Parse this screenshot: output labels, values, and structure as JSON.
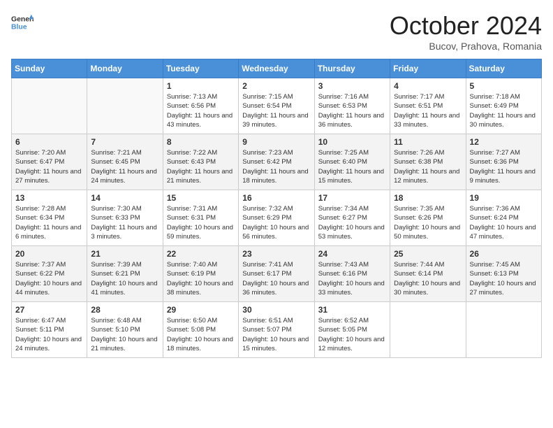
{
  "header": {
    "logo_general": "General",
    "logo_blue": "Blue",
    "month": "October 2024",
    "location": "Bucov, Prahova, Romania"
  },
  "weekdays": [
    "Sunday",
    "Monday",
    "Tuesday",
    "Wednesday",
    "Thursday",
    "Friday",
    "Saturday"
  ],
  "weeks": [
    [
      {
        "day": "",
        "sunrise": "",
        "sunset": "",
        "daylight": ""
      },
      {
        "day": "",
        "sunrise": "",
        "sunset": "",
        "daylight": ""
      },
      {
        "day": "1",
        "sunrise": "Sunrise: 7:13 AM",
        "sunset": "Sunset: 6:56 PM",
        "daylight": "Daylight: 11 hours and 43 minutes."
      },
      {
        "day": "2",
        "sunrise": "Sunrise: 7:15 AM",
        "sunset": "Sunset: 6:54 PM",
        "daylight": "Daylight: 11 hours and 39 minutes."
      },
      {
        "day": "3",
        "sunrise": "Sunrise: 7:16 AM",
        "sunset": "Sunset: 6:53 PM",
        "daylight": "Daylight: 11 hours and 36 minutes."
      },
      {
        "day": "4",
        "sunrise": "Sunrise: 7:17 AM",
        "sunset": "Sunset: 6:51 PM",
        "daylight": "Daylight: 11 hours and 33 minutes."
      },
      {
        "day": "5",
        "sunrise": "Sunrise: 7:18 AM",
        "sunset": "Sunset: 6:49 PM",
        "daylight": "Daylight: 11 hours and 30 minutes."
      }
    ],
    [
      {
        "day": "6",
        "sunrise": "Sunrise: 7:20 AM",
        "sunset": "Sunset: 6:47 PM",
        "daylight": "Daylight: 11 hours and 27 minutes."
      },
      {
        "day": "7",
        "sunrise": "Sunrise: 7:21 AM",
        "sunset": "Sunset: 6:45 PM",
        "daylight": "Daylight: 11 hours and 24 minutes."
      },
      {
        "day": "8",
        "sunrise": "Sunrise: 7:22 AM",
        "sunset": "Sunset: 6:43 PM",
        "daylight": "Daylight: 11 hours and 21 minutes."
      },
      {
        "day": "9",
        "sunrise": "Sunrise: 7:23 AM",
        "sunset": "Sunset: 6:42 PM",
        "daylight": "Daylight: 11 hours and 18 minutes."
      },
      {
        "day": "10",
        "sunrise": "Sunrise: 7:25 AM",
        "sunset": "Sunset: 6:40 PM",
        "daylight": "Daylight: 11 hours and 15 minutes."
      },
      {
        "day": "11",
        "sunrise": "Sunrise: 7:26 AM",
        "sunset": "Sunset: 6:38 PM",
        "daylight": "Daylight: 11 hours and 12 minutes."
      },
      {
        "day": "12",
        "sunrise": "Sunrise: 7:27 AM",
        "sunset": "Sunset: 6:36 PM",
        "daylight": "Daylight: 11 hours and 9 minutes."
      }
    ],
    [
      {
        "day": "13",
        "sunrise": "Sunrise: 7:28 AM",
        "sunset": "Sunset: 6:34 PM",
        "daylight": "Daylight: 11 hours and 6 minutes."
      },
      {
        "day": "14",
        "sunrise": "Sunrise: 7:30 AM",
        "sunset": "Sunset: 6:33 PM",
        "daylight": "Daylight: 11 hours and 3 minutes."
      },
      {
        "day": "15",
        "sunrise": "Sunrise: 7:31 AM",
        "sunset": "Sunset: 6:31 PM",
        "daylight": "Daylight: 10 hours and 59 minutes."
      },
      {
        "day": "16",
        "sunrise": "Sunrise: 7:32 AM",
        "sunset": "Sunset: 6:29 PM",
        "daylight": "Daylight: 10 hours and 56 minutes."
      },
      {
        "day": "17",
        "sunrise": "Sunrise: 7:34 AM",
        "sunset": "Sunset: 6:27 PM",
        "daylight": "Daylight: 10 hours and 53 minutes."
      },
      {
        "day": "18",
        "sunrise": "Sunrise: 7:35 AM",
        "sunset": "Sunset: 6:26 PM",
        "daylight": "Daylight: 10 hours and 50 minutes."
      },
      {
        "day": "19",
        "sunrise": "Sunrise: 7:36 AM",
        "sunset": "Sunset: 6:24 PM",
        "daylight": "Daylight: 10 hours and 47 minutes."
      }
    ],
    [
      {
        "day": "20",
        "sunrise": "Sunrise: 7:37 AM",
        "sunset": "Sunset: 6:22 PM",
        "daylight": "Daylight: 10 hours and 44 minutes."
      },
      {
        "day": "21",
        "sunrise": "Sunrise: 7:39 AM",
        "sunset": "Sunset: 6:21 PM",
        "daylight": "Daylight: 10 hours and 41 minutes."
      },
      {
        "day": "22",
        "sunrise": "Sunrise: 7:40 AM",
        "sunset": "Sunset: 6:19 PM",
        "daylight": "Daylight: 10 hours and 38 minutes."
      },
      {
        "day": "23",
        "sunrise": "Sunrise: 7:41 AM",
        "sunset": "Sunset: 6:17 PM",
        "daylight": "Daylight: 10 hours and 36 minutes."
      },
      {
        "day": "24",
        "sunrise": "Sunrise: 7:43 AM",
        "sunset": "Sunset: 6:16 PM",
        "daylight": "Daylight: 10 hours and 33 minutes."
      },
      {
        "day": "25",
        "sunrise": "Sunrise: 7:44 AM",
        "sunset": "Sunset: 6:14 PM",
        "daylight": "Daylight: 10 hours and 30 minutes."
      },
      {
        "day": "26",
        "sunrise": "Sunrise: 7:45 AM",
        "sunset": "Sunset: 6:13 PM",
        "daylight": "Daylight: 10 hours and 27 minutes."
      }
    ],
    [
      {
        "day": "27",
        "sunrise": "Sunrise: 6:47 AM",
        "sunset": "Sunset: 5:11 PM",
        "daylight": "Daylight: 10 hours and 24 minutes."
      },
      {
        "day": "28",
        "sunrise": "Sunrise: 6:48 AM",
        "sunset": "Sunset: 5:10 PM",
        "daylight": "Daylight: 10 hours and 21 minutes."
      },
      {
        "day": "29",
        "sunrise": "Sunrise: 6:50 AM",
        "sunset": "Sunset: 5:08 PM",
        "daylight": "Daylight: 10 hours and 18 minutes."
      },
      {
        "day": "30",
        "sunrise": "Sunrise: 6:51 AM",
        "sunset": "Sunset: 5:07 PM",
        "daylight": "Daylight: 10 hours and 15 minutes."
      },
      {
        "day": "31",
        "sunrise": "Sunrise: 6:52 AM",
        "sunset": "Sunset: 5:05 PM",
        "daylight": "Daylight: 10 hours and 12 minutes."
      },
      {
        "day": "",
        "sunrise": "",
        "sunset": "",
        "daylight": ""
      },
      {
        "day": "",
        "sunrise": "",
        "sunset": "",
        "daylight": ""
      }
    ]
  ]
}
